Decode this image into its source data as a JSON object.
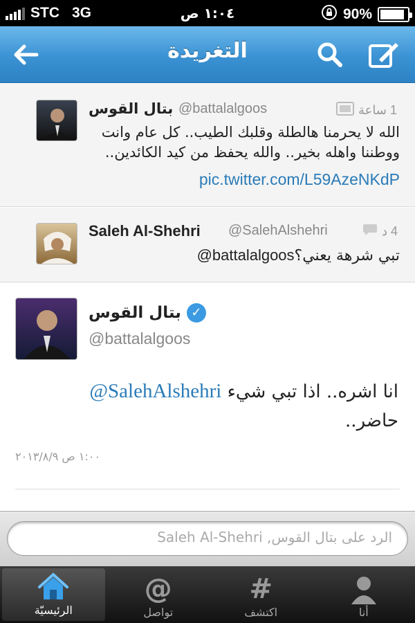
{
  "status": {
    "carrier": "STC",
    "network": "3G",
    "time": "١:٠٤ ص",
    "battery": "90%"
  },
  "nav": {
    "title": "التغريدة"
  },
  "tweets": [
    {
      "name": "بتال القوس",
      "handle": "@battalalgoos",
      "time": "1 ساعة",
      "text": "الله لا يحرمنا هالطلة وقلبك الطيب.. كل عام وانت ووطننا واهله بخير.. والله يحفظ من كيد الكائدين..",
      "link": "pic.twitter.com/L59AzeNKdP"
    },
    {
      "name": "Saleh Al-Shehri",
      "handle": "@SalehAlshehri",
      "time": "4 د",
      "text_mention": "@battalalgoos",
      "text": "تبي شرهة يعني؟"
    }
  ],
  "detail": {
    "name": "بتال القوس",
    "handle": "@battalalgoos",
    "mention": "@SalehAlshehri",
    "text1": "انا اشره.. اذا تبي شيء",
    "text2": "حاضر..",
    "timestamp": "١:٠٠ ص ٢٠١٣/٨/٩"
  },
  "reply": {
    "placeholder": "الرد على بتال القوس, Saleh Al-Shehri"
  },
  "tabs": [
    {
      "label": "الرئيسيّة"
    },
    {
      "label": "تواصل"
    },
    {
      "label": "اكتشف"
    },
    {
      "label": "أنا"
    }
  ]
}
